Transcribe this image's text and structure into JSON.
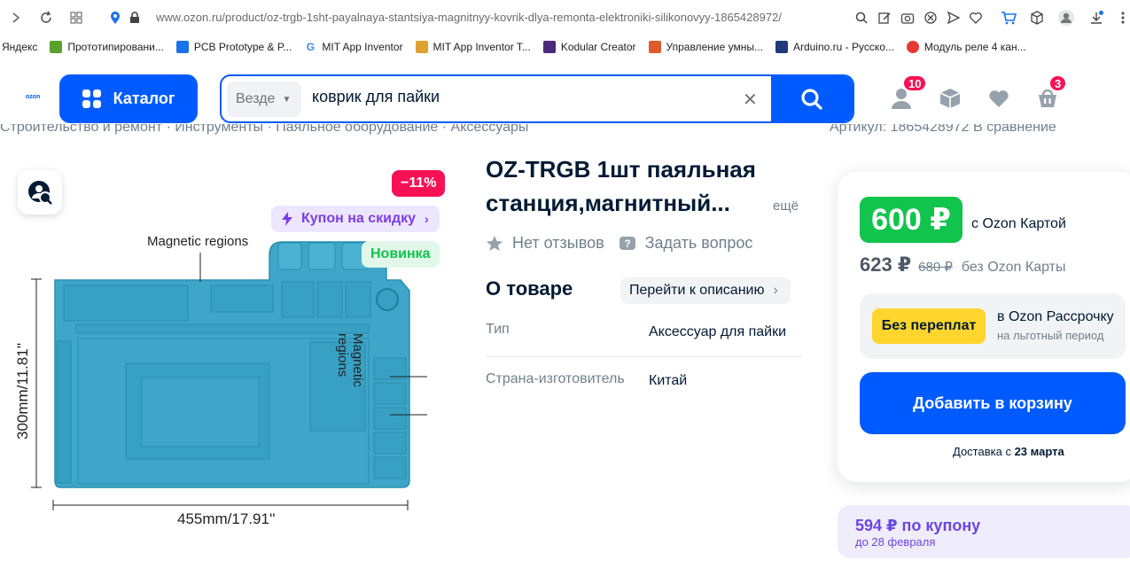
{
  "browser": {
    "url": "www.ozon.ru/product/oz-trgb-1sht-payalnaya-stantsiya-magnitnyy-kovrik-dlya-remonta-elektroniki-silikonovyy-1865428972/",
    "bookmarks": [
      {
        "label": "Яндекс",
        "color": "#ffffff"
      },
      {
        "label": "Прототипировани...",
        "color": "#5aa02c"
      },
      {
        "label": "PCB Prototype & P...",
        "color": "#1a73e8"
      },
      {
        "label": "MIT App Inventor",
        "color": "#4285f4"
      },
      {
        "label": "MIT App Inventor T...",
        "color": "#e0a030"
      },
      {
        "label": "Kodular Creator",
        "color": "#4b2a7a"
      },
      {
        "label": "Управление умны...",
        "color": "#e05b2a"
      },
      {
        "label": "Arduino.ru - Русско...",
        "color": "#1f3a7a"
      },
      {
        "label": "Модуль реле 4 кан...",
        "color": "#e53935"
      }
    ]
  },
  "header": {
    "logo": "ozon",
    "catalog_label": "Каталог",
    "search_scope": "Везде",
    "search_value": "коврик для пайки",
    "profile_badge": "10",
    "cart_badge": "3"
  },
  "breadcrumbs": {
    "left": "Строительство и ремонт  ·  Инструменты  ·  Паяльное оборудование  ·  Аксессуары",
    "right": "Артикул: 1865428972     В сравнение"
  },
  "product": {
    "discount_badge": "−11%",
    "coupon_tag": "Купон на скидку",
    "new_tag": "Новинка",
    "image_labels": {
      "top": "Magnetic regions",
      "right": "Magnetic regions",
      "height": "300mm/11.81''",
      "width": "455mm/17.91''"
    },
    "title": "OZ-TRGB 1шт паяльная станция,магнитный...",
    "more_link": "ещё",
    "reviews": "Нет отзывов",
    "ask_question": "Задать вопрос",
    "about_heading": "О товаре",
    "goto_description": "Перейти к описанию",
    "specs": [
      {
        "key": "Тип",
        "value": "Аксессуар для пайки"
      },
      {
        "key": "Страна-изготовитель",
        "value": "Китай"
      }
    ]
  },
  "pricing": {
    "card_price": "600 ₽",
    "card_note": "с Ozon Картой",
    "regular_price": "623 ₽",
    "old_price": "680 ₽",
    "no_card_note": "без Ozon Карты",
    "installment_pill": "Без переплат",
    "installment_title": "в Ozon Рассрочку",
    "installment_sub": "на льготный период",
    "add_to_cart": "Добавить в корзину",
    "delivery_prefix": "Доставка с",
    "delivery_date": "23 марта",
    "coupon_price": "594 ₽ по купону",
    "coupon_until": "до 28 февраля"
  },
  "colors": {
    "brand_blue": "#005bff",
    "discount_red": "#f91155",
    "price_green": "#10c44c",
    "coupon_purple": "#7b3fe4",
    "mat_teal": "#3fa6c9"
  }
}
